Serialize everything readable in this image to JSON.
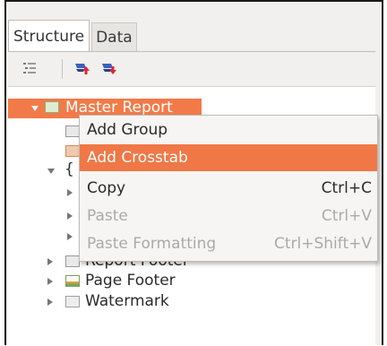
{
  "tabs": [
    {
      "label": "Structure",
      "active": true
    },
    {
      "label": "Data",
      "active": false
    }
  ],
  "toolbar": {
    "icons": [
      "outline-view-icon",
      "move-up-icon",
      "move-down-icon"
    ]
  },
  "tree": {
    "root": {
      "label": "Master Report",
      "selected": true
    },
    "items": [
      {
        "label": "Report Footer",
        "partially_hidden": true
      },
      {
        "label": "Page Footer"
      },
      {
        "label": "Watermark"
      }
    ],
    "hidden_group_prefix": "{"
  },
  "context_menu": {
    "items": [
      {
        "label": "Add Group",
        "shortcut": "",
        "enabled": true,
        "highlighted": false
      },
      {
        "label": "Add Crosstab",
        "shortcut": "",
        "enabled": true,
        "highlighted": true
      },
      {
        "label": "Copy",
        "shortcut": "Ctrl+C",
        "enabled": true,
        "highlighted": false
      },
      {
        "label": "Paste",
        "shortcut": "Ctrl+V",
        "enabled": false,
        "highlighted": false
      },
      {
        "label": "Paste Formatting",
        "shortcut": "Ctrl+Shift+V",
        "enabled": false,
        "highlighted": false
      }
    ]
  },
  "colors": {
    "selection": "#f27a48",
    "menu_highlight": "#f07746",
    "disabled_text": "#aaaaaa"
  }
}
